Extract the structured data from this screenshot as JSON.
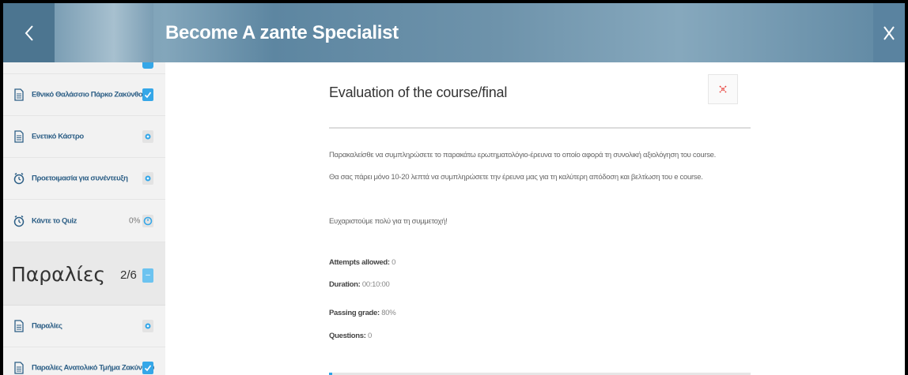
{
  "header": {
    "title": "Become A zante Specialist"
  },
  "sidebar": {
    "items": [
      {
        "label": "Εθνικό Θαλάσσιο Πάρκο Ζακύνθου",
        "status": "completed",
        "icon": "document-icon"
      },
      {
        "label": "Ενετικό Κάστρο",
        "status": "preview",
        "icon": "document-icon"
      },
      {
        "label": "Προετοιμασία για συνέντευξη",
        "status": "preview",
        "icon": "clock-icon"
      },
      {
        "label": "Κάντε το Quiz",
        "status": "in-progress",
        "percent": "0%",
        "icon": "clock-icon"
      }
    ],
    "section": {
      "name": "Παραλίες",
      "count": "2/6",
      "toggle": "–"
    },
    "section_items": [
      {
        "label": "Παραλίες",
        "status": "preview",
        "icon": "document-icon"
      },
      {
        "label": "Παραλίες Ανατολικό Τμήμα Ζακύνθου",
        "status": "completed",
        "icon": "document-icon"
      }
    ]
  },
  "main": {
    "lesson_title": "Evaluation of the course/final",
    "paragraph_1": "Παρακαλείσθε να συμπληρώσετε το παρακάτω ερωτηματολόγιο-έρευνα το οποίο αφορά τη συνολική αξιολόγηση του course.",
    "paragraph_2": "Θα σας πάρει μόνο 10-20 λεπτά να συμπληρώσετε την έρευνα μας για τη καλύτερη απόδοση και βελτίωση του e course.",
    "paragraph_3": "Ευχαριστούμε πολύ για τη συμμετοχή!",
    "meta": {
      "attempts_label": "Attempts allowed:",
      "attempts_value": "0",
      "duration_label": "Duration:",
      "duration_value": "00:10:00",
      "passing_label": "Passing grade:",
      "passing_value": "80%",
      "questions_label": "Questions:",
      "questions_value": "0"
    }
  },
  "colors": {
    "accent": "#35a7e8",
    "close_red": "#e8423c",
    "header_blue": "#5d86a1"
  }
}
